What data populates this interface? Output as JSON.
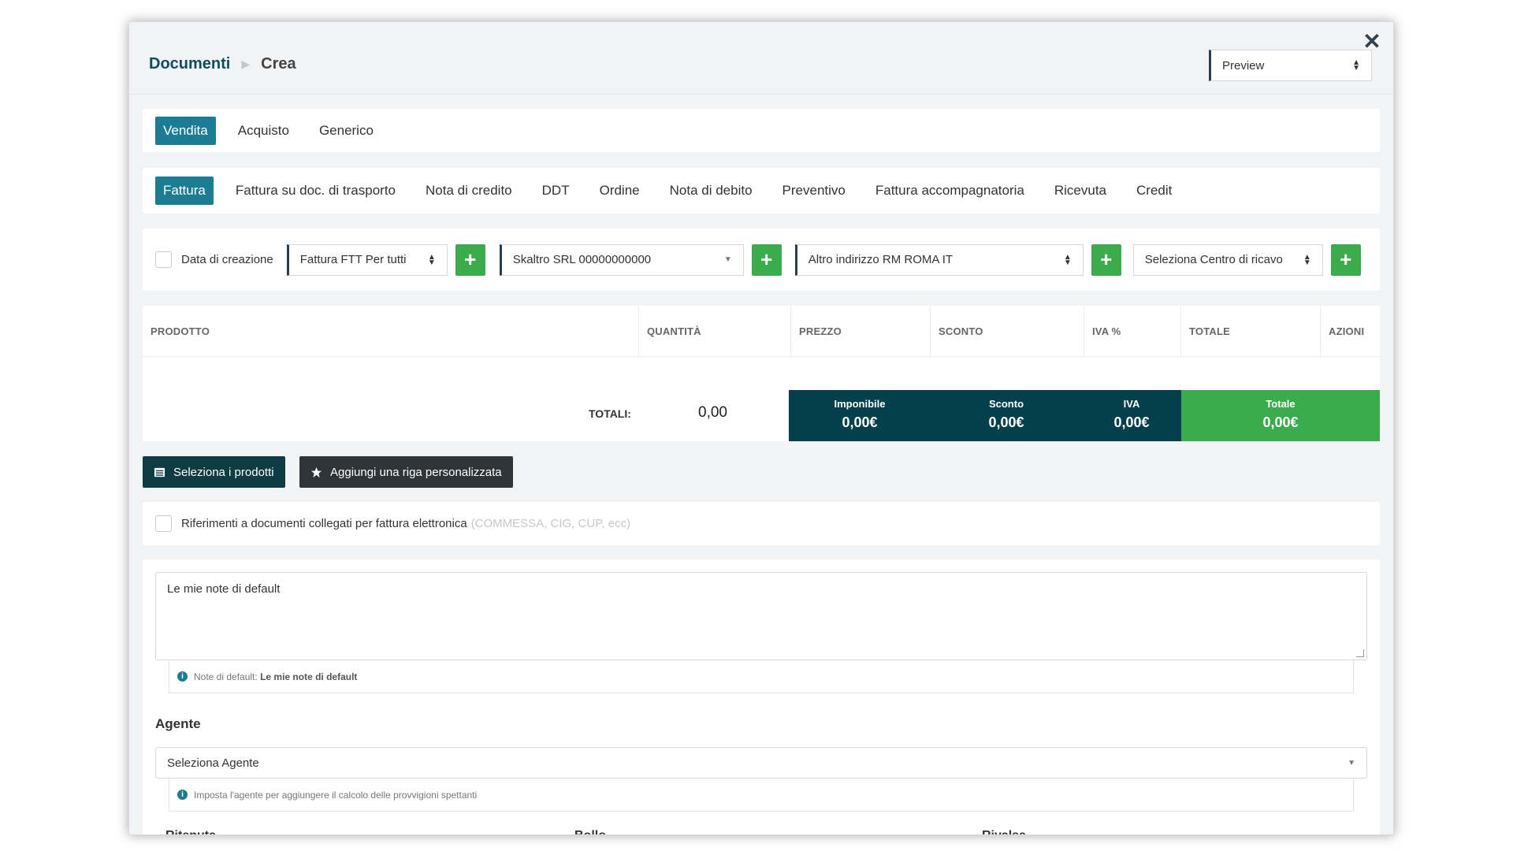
{
  "breadcrumb": {
    "root": "Documenti",
    "current": "Crea"
  },
  "preview_select": {
    "value": "Preview"
  },
  "doc_direction_tabs": [
    {
      "label": "Vendita",
      "active": true
    },
    {
      "label": "Acquisto",
      "active": false
    },
    {
      "label": "Generico",
      "active": false
    }
  ],
  "doc_type_tabs": [
    {
      "label": "Fattura",
      "active": true
    },
    {
      "label": "Fattura su doc. di trasporto",
      "active": false
    },
    {
      "label": "Nota di credito",
      "active": false
    },
    {
      "label": "DDT",
      "active": false
    },
    {
      "label": "Ordine",
      "active": false
    },
    {
      "label": "Nota di debito",
      "active": false
    },
    {
      "label": "Preventivo",
      "active": false
    },
    {
      "label": "Fattura accompagnatoria",
      "active": false
    },
    {
      "label": "Ricevuta",
      "active": false
    },
    {
      "label": "Credit",
      "active": false
    }
  ],
  "form": {
    "date_label": "Data di creazione",
    "numbering_value": "Fattura FTT Per tutti",
    "customer_value": "Skaltro SRL 00000000000",
    "address_value": "Altro indirizzo RM ROMA IT",
    "revenue_center_value": "Seleziona Centro di ricavo",
    "plus_symbol": "+"
  },
  "table": {
    "columns": [
      "PRODOTTO",
      "QUANTITÀ",
      "PREZZO",
      "SCONTO",
      "IVA %",
      "TOTALE",
      "AZIONI"
    ],
    "totals_label": "TOTALI:",
    "total_quantity": "0,00",
    "summary": {
      "imponibile_label": "Imponibile",
      "imponibile_value": "0,00€",
      "sconto_label": "Sconto",
      "sconto_value": "0,00€",
      "iva_label": "IVA",
      "iva_value": "0,00€",
      "totale_label": "Totale",
      "totale_value": "0,00€"
    }
  },
  "buttons": {
    "select_products": "Seleziona i prodotti",
    "add_custom_row": "Aggiungi una riga personalizzata"
  },
  "references": {
    "label": "Riferimenti a documenti collegati per fattura elettronica",
    "hint": "(COMMESSA, CIG, CUP, ecc)"
  },
  "notes": {
    "value": "Le mie note di default",
    "hint_prefix": "Note di default:",
    "hint_value": "Le mie note di default"
  },
  "agent": {
    "title": "Agente",
    "select_value": "Seleziona Agente",
    "hint": "Imposta l'agente per aggiungere il calcolo delle provvigioni spettanti"
  },
  "footer_labels": {
    "ritenuta": "Ritenuta",
    "bollo": "Bollo",
    "rivalsa": "Rivalsa"
  },
  "colors": {
    "accent": "#1c7d92",
    "dark_teal": "#04404b",
    "green": "#3cab4c",
    "button_dark": "#0f3b45"
  }
}
